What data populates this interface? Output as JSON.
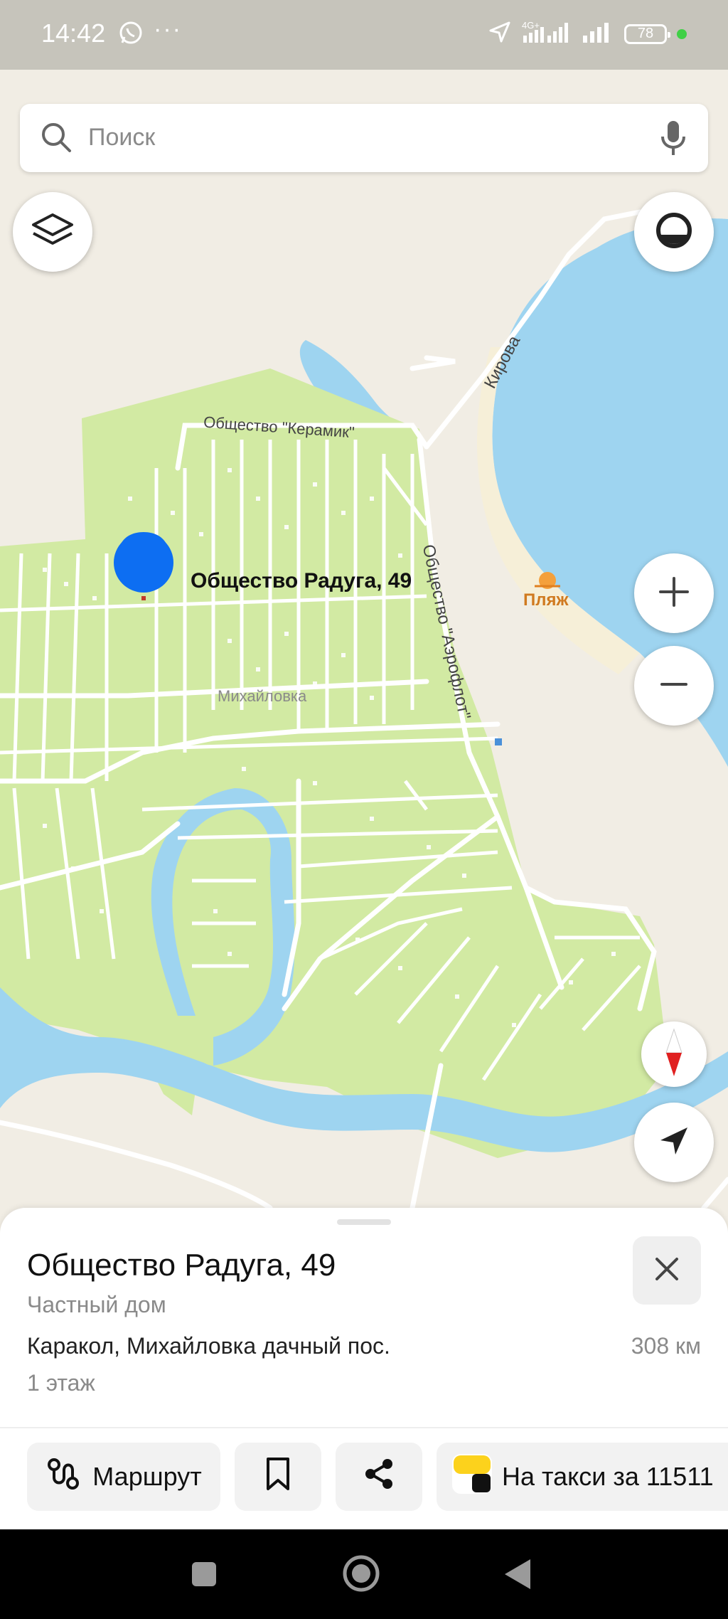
{
  "status_bar": {
    "time": "14:42",
    "battery": "78",
    "network": "4G+"
  },
  "search": {
    "placeholder": "Поиск"
  },
  "map": {
    "pin_label": "Общество Радуга, 49",
    "labels": {
      "keramik": "Общество \"Керамик\"",
      "kirova": "Кирова",
      "aeroflot": "Общество \"Аэрофлот\"",
      "beach": "Пляж",
      "village": "Михайловка"
    },
    "colors": {
      "land": "#f1ede4",
      "green": "#d2eaa3",
      "water": "#9ed4f0",
      "road": "#ffffff",
      "pin": "#0d6ef2"
    }
  },
  "place": {
    "title": "Общество Радуга, 49",
    "type": "Частный дом",
    "address": "Каракол, Михайловка дачный пос.",
    "distance": "308 км",
    "floors": "1 этаж"
  },
  "actions": {
    "route": "Маршрут",
    "taxi": "На такси за 11511"
  },
  "icons": [
    "search-icon",
    "mic-icon",
    "layers-icon",
    "assistant-icon",
    "zoom-in-icon",
    "zoom-out-icon",
    "compass-icon",
    "my-location-icon",
    "close-icon",
    "route-icon",
    "bookmark-icon",
    "share-icon",
    "taxi-icon",
    "whatsapp-icon"
  ]
}
